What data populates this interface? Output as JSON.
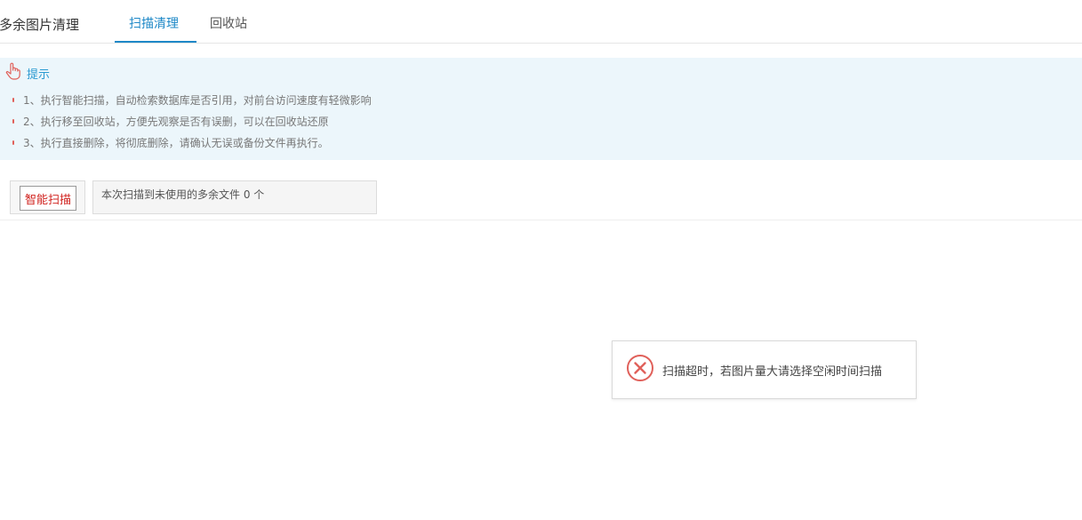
{
  "header": {
    "title": "多余图片清理",
    "tabs": [
      {
        "label": "扫描清理",
        "active": true
      },
      {
        "label": "回收站",
        "active": false
      }
    ]
  },
  "tips": {
    "icon": "hand-pointer-icon",
    "title": "提示",
    "items": [
      "1、执行智能扫描，自动检索数据库是否引用，对前台访问速度有轻微影响",
      "2、执行移至回收站，方便先观察是否有误删，可以在回收站还原",
      "3、执行直接删除，将彻底删除，请确认无误或备份文件再执行。"
    ]
  },
  "toolbar": {
    "scan_label": "智能扫描",
    "result_text": "本次扫描到未使用的多余文件 0 个"
  },
  "toast": {
    "icon": "error-circle-icon",
    "message": "扫描超时，若图片量大请选择空闲时间扫描"
  },
  "colors": {
    "accent": "#1e88c7",
    "tips_background": "#ecf6fb",
    "danger": "#d0221e",
    "error_icon": "#e0605a"
  }
}
